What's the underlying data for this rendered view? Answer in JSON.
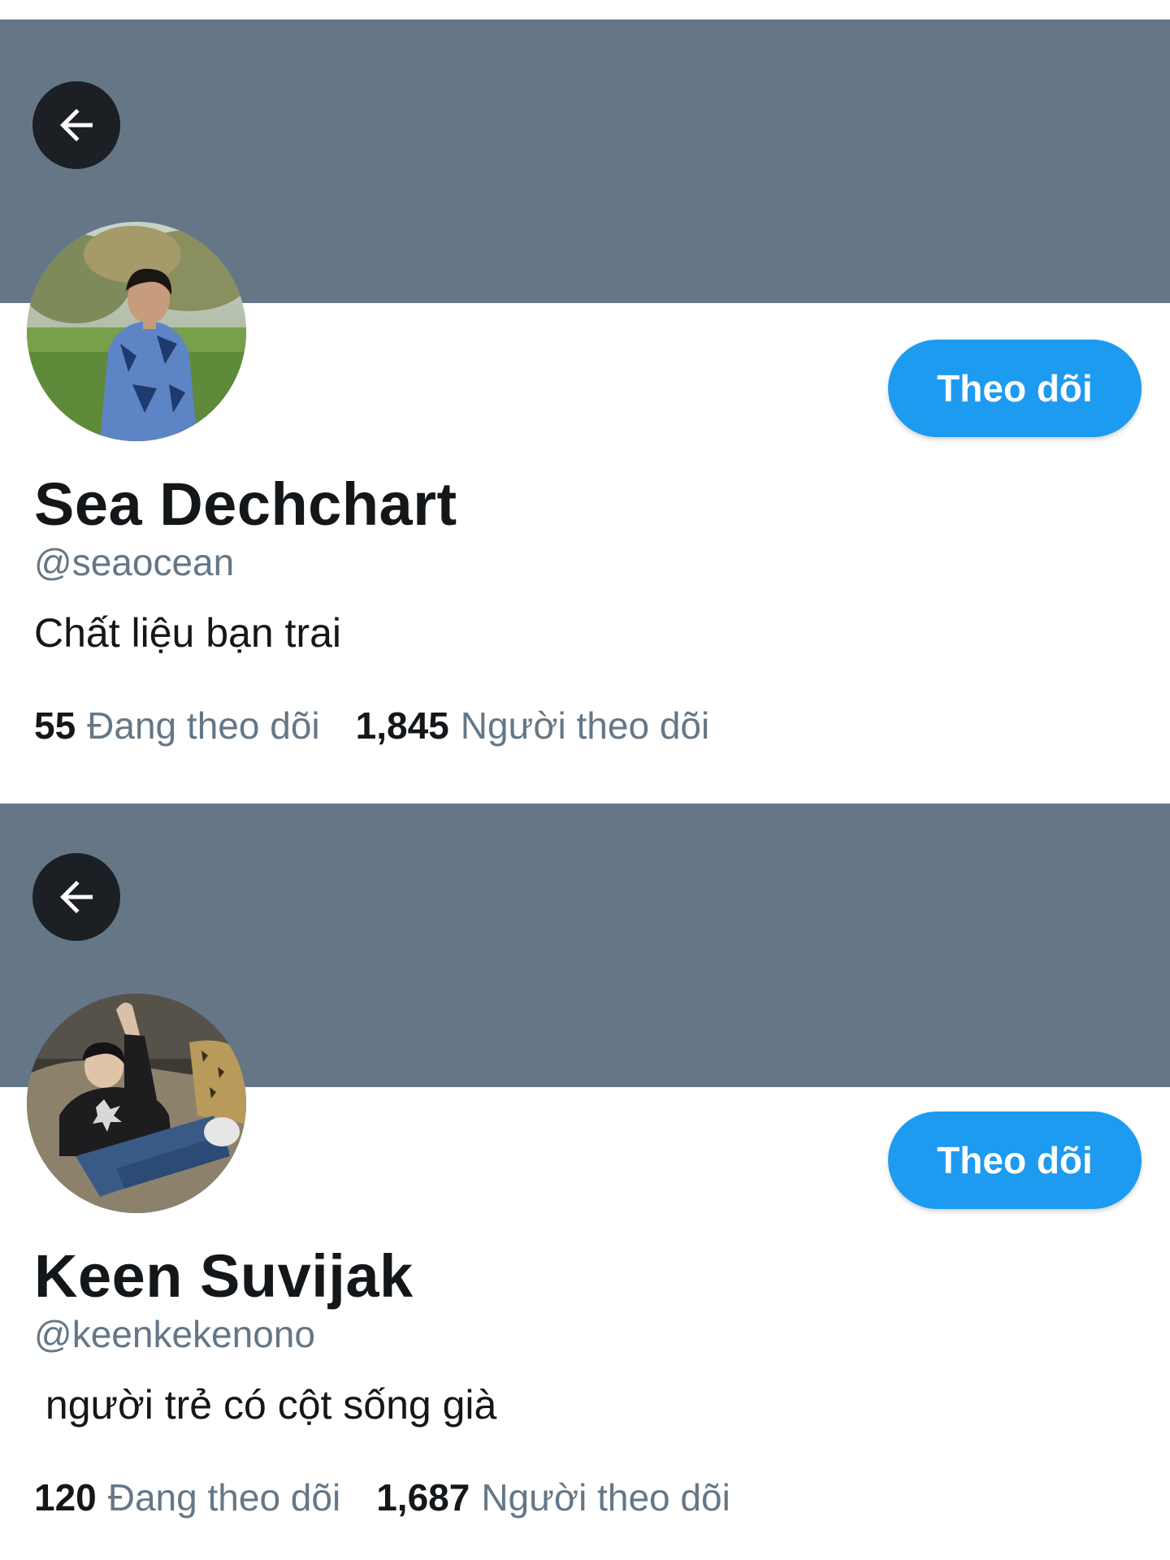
{
  "colors": {
    "banner": "#657786",
    "accent": "#1d9bf0",
    "secondary_text": "#657786",
    "primary_text": "#14171a",
    "back_button": "#1c1f23"
  },
  "profiles": [
    {
      "display_name": "Sea Dechchart",
      "handle": "@seaocean",
      "bio": "Chất liệu bạn trai",
      "follow_label": "Theo dõi",
      "following_count": "55",
      "following_label": "Đang theo dõi",
      "followers_count": "1,845",
      "followers_label": "Người theo dõi",
      "back_icon": "arrow-left-icon"
    },
    {
      "display_name": "Keen Suvijak",
      "handle": "@keenkekenono",
      "bio": " người trẻ có cột sống già",
      "follow_label": "Theo dõi",
      "following_count": "120",
      "following_label": "Đang theo dõi",
      "followers_count": "1,687",
      "followers_label": "Người theo dõi",
      "back_icon": "arrow-left-icon"
    }
  ]
}
